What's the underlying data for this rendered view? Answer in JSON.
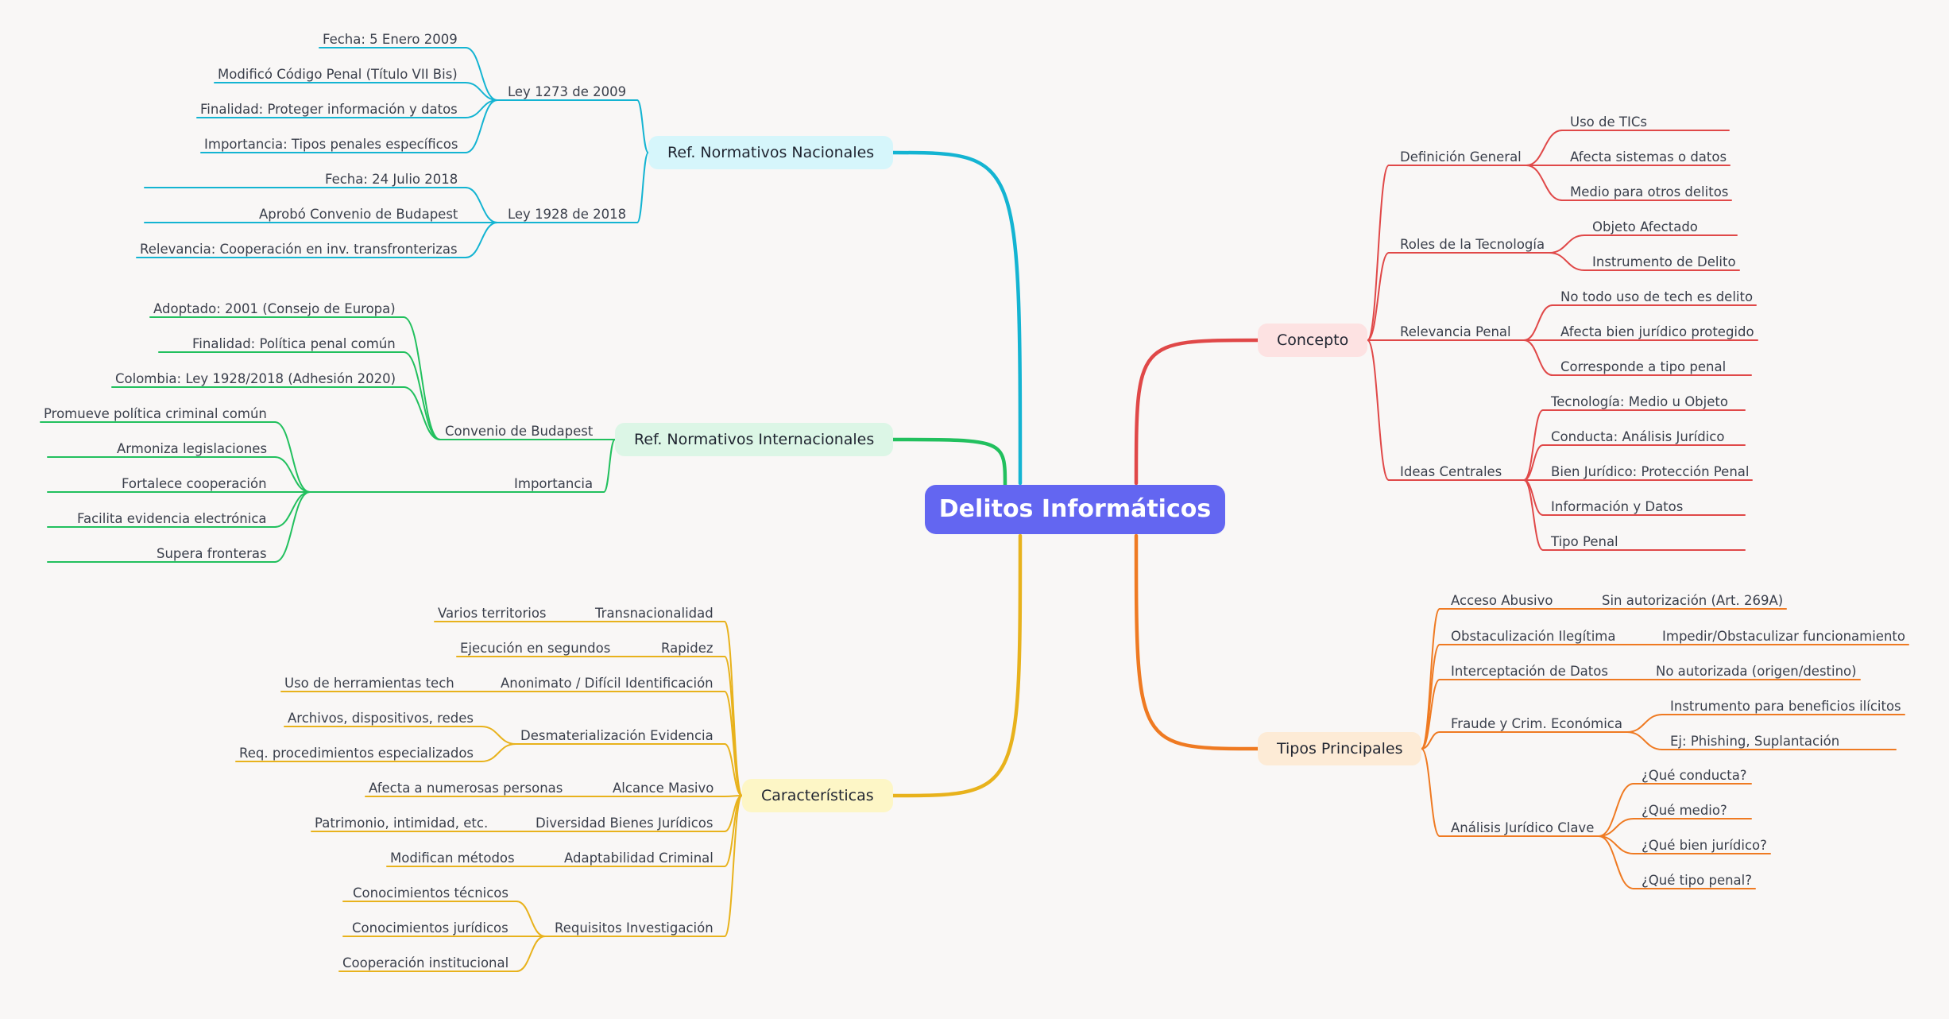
{
  "root": {
    "label": "Delitos Informáticos",
    "color": "#6366f1"
  },
  "branches": [
    {
      "id": "concepto",
      "label": "Concepto",
      "side": "right",
      "color": "#e04848",
      "bg": "#fde2e2",
      "children": [
        {
          "label": "Definición General",
          "children": [
            {
              "label": "Uso de TICs"
            },
            {
              "label": "Afecta sistemas o datos"
            },
            {
              "label": "Medio para otros delitos"
            }
          ]
        },
        {
          "label": "Roles de la Tecnología",
          "children": [
            {
              "label": "Objeto Afectado"
            },
            {
              "label": "Instrumento de Delito"
            }
          ]
        },
        {
          "label": "Relevancia Penal",
          "children": [
            {
              "label": "No todo uso de tech es delito"
            },
            {
              "label": "Afecta bien jurídico protegido"
            },
            {
              "label": "Corresponde a tipo penal"
            }
          ]
        },
        {
          "label": "Ideas Centrales",
          "children": [
            {
              "label": "Tecnología: Medio u Objeto"
            },
            {
              "label": "Conducta: Análisis Jurídico"
            },
            {
              "label": "Bien Jurídico: Protección Penal"
            },
            {
              "label": "Información y Datos"
            },
            {
              "label": "Tipo Penal"
            }
          ]
        }
      ]
    },
    {
      "id": "tipos",
      "label": "Tipos Principales",
      "side": "right",
      "color": "#ef7a22",
      "bg": "#fdebd6",
      "children": [
        {
          "label": "Acceso Abusivo",
          "children": [
            {
              "label": "Sin autorización (Art. 269A)"
            }
          ]
        },
        {
          "label": "Obstaculización Ilegítima",
          "children": [
            {
              "label": "Impedir/Obstaculizar funcionamiento"
            }
          ]
        },
        {
          "label": "Interceptación de Datos",
          "children": [
            {
              "label": "No autorizada (origen/destino)"
            }
          ]
        },
        {
          "label": "Fraude y Crim. Económica",
          "children": [
            {
              "label": "Instrumento para beneficios ilícitos"
            },
            {
              "label": "Ej: Phishing, Suplantación"
            }
          ]
        },
        {
          "label": "Análisis Jurídico Clave",
          "children": [
            {
              "label": "¿Qué conducta?"
            },
            {
              "label": "¿Qué medio?"
            },
            {
              "label": "¿Qué bien jurídico?"
            },
            {
              "label": "¿Qué tipo penal?"
            }
          ]
        }
      ]
    },
    {
      "id": "nacionales",
      "label": "Ref. Normativos Nacionales",
      "side": "left",
      "color": "#14b4d2",
      "bg": "#d6f6fb",
      "children": [
        {
          "label": "Ley 1273 de 2009",
          "children": [
            {
              "label": "Fecha: 5 Enero 2009"
            },
            {
              "label": "Modificó Código Penal (Título VII Bis)"
            },
            {
              "label": "Finalidad: Proteger información y datos"
            },
            {
              "label": "Importancia: Tipos penales específicos"
            }
          ]
        },
        {
          "label": "Ley 1928 de 2018",
          "children": [
            {
              "label": "Fecha: 24 Julio 2018"
            },
            {
              "label": "Aprobó Convenio de Budapest"
            },
            {
              "label": "Relevancia: Cooperación en inv. transfronterizas"
            }
          ]
        }
      ]
    },
    {
      "id": "internacionales",
      "label": "Ref. Normativos Internacionales",
      "side": "left",
      "color": "#22c05e",
      "bg": "#dcf6e6",
      "children": [
        {
          "label": "Convenio de Budapest",
          "children": [
            {
              "label": "Adoptado: 2001 (Consejo de Europa)"
            },
            {
              "label": "Finalidad: Política penal común"
            },
            {
              "label": "Colombia: Ley 1928/2018 (Adhesión 2020)"
            }
          ]
        },
        {
          "label": "Importancia",
          "children": [
            {
              "label": "Promueve política criminal común"
            },
            {
              "label": "Armoniza legislaciones"
            },
            {
              "label": "Fortalece cooperación"
            },
            {
              "label": "Facilita evidencia electrónica"
            },
            {
              "label": "Supera fronteras"
            }
          ]
        }
      ]
    },
    {
      "id": "caracteristicas",
      "label": "Características",
      "side": "left",
      "color": "#e8b21c",
      "bg": "#fdf6c6",
      "children": [
        {
          "label": "Transnacionalidad",
          "children": [
            {
              "label": "Varios territorios"
            }
          ]
        },
        {
          "label": "Rapidez",
          "children": [
            {
              "label": "Ejecución en segundos"
            }
          ]
        },
        {
          "label": "Anonimato / Difícil Identificación",
          "children": [
            {
              "label": "Uso de herramientas tech"
            }
          ]
        },
        {
          "label": "Desmaterialización Evidencia",
          "children": [
            {
              "label": "Archivos, dispositivos, redes"
            },
            {
              "label": "Req. procedimientos especializados"
            }
          ]
        },
        {
          "label": "Alcance Masivo",
          "children": [
            {
              "label": "Afecta a numerosas personas"
            }
          ]
        },
        {
          "label": "Diversidad Bienes Jurídicos",
          "children": [
            {
              "label": "Patrimonio, intimidad, etc."
            }
          ]
        },
        {
          "label": "Adaptabilidad Criminal",
          "children": [
            {
              "label": "Modifican métodos"
            }
          ]
        },
        {
          "label": "Requisitos Investigación",
          "children": [
            {
              "label": "Conocimientos técnicos"
            },
            {
              "label": "Conocimientos jurídicos"
            },
            {
              "label": "Cooperación institucional"
            }
          ]
        }
      ]
    }
  ]
}
